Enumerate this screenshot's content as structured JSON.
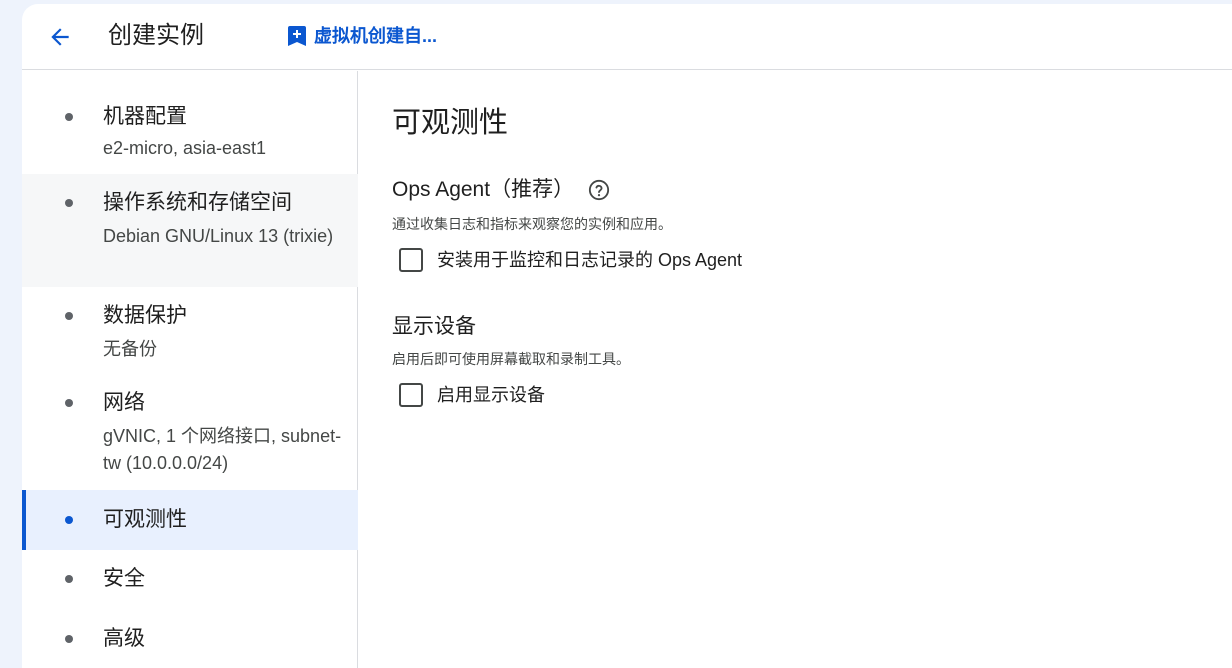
{
  "header": {
    "title": "创建实例",
    "link_label": "虚拟机创建自...",
    "back_icon": "arrow-back-icon",
    "link_icon": "bookmark-add-icon"
  },
  "sidebar": {
    "items": [
      {
        "label": "机器配置",
        "sub": "e2-micro, asia-east1"
      },
      {
        "label": "操作系统和存储空间",
        "sub": "Debian GNU/Linux 13 (trixie)"
      },
      {
        "label": "数据保护",
        "sub": "无备份"
      },
      {
        "label": "网络",
        "sub": "gVNIC, 1 个网络接口, subnet-tw (10.0.0.0/24)"
      },
      {
        "label": "可观测性",
        "sub": ""
      },
      {
        "label": "安全",
        "sub": ""
      },
      {
        "label": "高级",
        "sub": ""
      }
    ],
    "active": "可观测性"
  },
  "main": {
    "title": "可观测性",
    "ops_agent": {
      "title": "Ops Agent（推荐）",
      "description": "通过收集日志和指标来观察您的实例和应用。",
      "checkbox_label": "安装用于监控和日志记录的 Ops Agent",
      "checked": false
    },
    "display": {
      "title": "显示设备",
      "description": "启用后即可使用屏幕截取和录制工具。",
      "checkbox_label": "启用显示设备",
      "checked": false
    }
  },
  "colors": {
    "accent": "#0b57d0",
    "page_bg": "#eef3fc",
    "active_bg": "#e8f0fe"
  }
}
